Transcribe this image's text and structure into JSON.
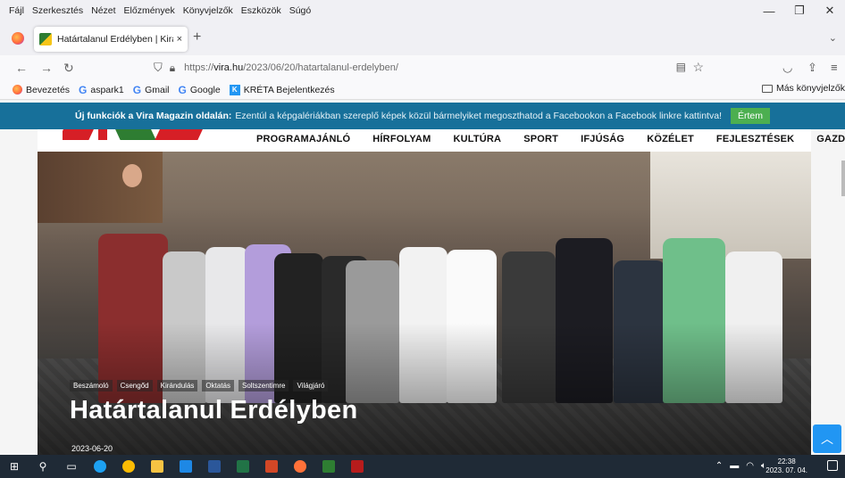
{
  "menu": [
    "Fájl",
    "Szerkesztés",
    "Nézet",
    "Előzmények",
    "Könyvjelzők",
    "Eszközök",
    "Súgó"
  ],
  "tab": {
    "title": "Határtalanul Erdélyben | Kirándu",
    "close": "×",
    "new": "+"
  },
  "url": {
    "prefix": "https://",
    "domain": "vira.hu",
    "path": "/2023/06/20/hatartalanul-erdelyben/"
  },
  "bookmarks": [
    {
      "label": "Bevezetés",
      "icon": "firefox-icon"
    },
    {
      "label": "aspark1",
      "icon": "google-icon"
    },
    {
      "label": "Gmail",
      "icon": "google-icon"
    },
    {
      "label": "Google",
      "icon": "google-icon"
    },
    {
      "label": "KRÉTA Bejelentkezés",
      "icon": "kreta-icon"
    }
  ],
  "bookmarks_other": "Más könyvjelzők",
  "notice": {
    "bold": "Új funkciók a Vira Magazin oldalán:",
    "text": "Ezentúl a képgalériákban szereplő képek közül bármelyiket megoszthatod a Facebookon a Facebook linkre kattintva!",
    "button": "Értem"
  },
  "nav": [
    "PROGRAMAJÁNLÓ",
    "HÍRFOLYAM",
    "KULTÚRA",
    "SPORT",
    "IFJÚSÁG",
    "KÖZÉLET",
    "FEJLESZTÉSEK",
    "GAZDASÁG"
  ],
  "article": {
    "tags": [
      "Beszámoló",
      "Csengőd",
      "Kirándulás",
      "Oktatás",
      "Soltszentimre",
      "Világjáró"
    ],
    "title": "Határtalanul Erdélyben",
    "date": "2023-06-20"
  },
  "clock": {
    "time": "22:38",
    "date": "2023. 07. 04."
  },
  "colors": {
    "notice_bg": "#17709a",
    "ok_btn": "#4caf50",
    "accent_red": "#d61f26",
    "accent_green": "#2e7d32",
    "totop": "#2196f3"
  }
}
